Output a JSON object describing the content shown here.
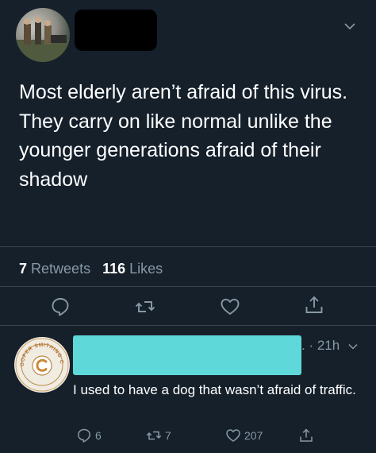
{
  "colors": {
    "background": "#15202b",
    "text": "#ffffff",
    "muted": "#8899a6",
    "divider": "#38444d",
    "redaction_name": "#000000",
    "redaction_reply": "#5ed8d8"
  },
  "tweet": {
    "text": "Most elderly aren’t afraid of this virus. They carry on like normal unlike the younger generations afraid of their shadow",
    "retweets_count": "7",
    "retweets_label": "Retweets",
    "likes_count": "116",
    "likes_label": "Likes",
    "icons": [
      "reply-icon",
      "retweet-icon",
      "like-icon",
      "share-icon"
    ]
  },
  "reply": {
    "time": ". · 21h",
    "text": "I used to have a dog that wasn’t afraid of traffic.",
    "reply_count": "6",
    "retweet_count": "7",
    "like_count": "207",
    "avatar_logo_text": "COOPER SMITHING CO."
  }
}
